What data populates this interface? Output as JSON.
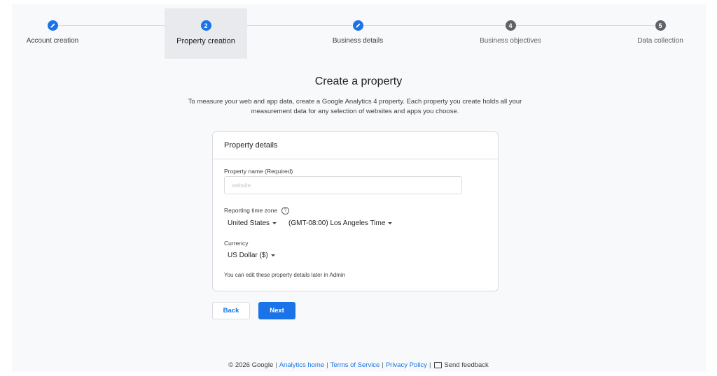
{
  "stepper": {
    "steps": [
      {
        "label": "Account creation",
        "state": "done",
        "icon": "pencil-icon"
      },
      {
        "label": "Property creation",
        "state": "active",
        "number": "2"
      },
      {
        "label": "Business details",
        "state": "done",
        "icon": "pencil-icon"
      },
      {
        "label": "Business objectives",
        "state": "pending",
        "number": "4"
      },
      {
        "label": "Data collection",
        "state": "pending",
        "number": "5"
      }
    ]
  },
  "page": {
    "title": "Create a property",
    "description": "To measure your web and app data, create a Google Analytics 4 property. Each property you create holds all your measurement data for any selection of websites and apps you choose."
  },
  "card": {
    "header": "Property details",
    "property_name_label": "Property name (Required)",
    "property_name_value": "website",
    "time_zone_label": "Reporting time zone",
    "country": "United States",
    "time_zone": "(GMT-08:00) Los Angeles Time",
    "currency_label": "Currency",
    "currency": "US Dollar ($)",
    "note": "You can edit these property details later in Admin"
  },
  "buttons": {
    "back": "Back",
    "next": "Next"
  },
  "footer": {
    "copyright": "© 2026 Google",
    "links": [
      "Analytics home",
      "Terms of Service",
      "Privacy Policy"
    ],
    "feedback": "Send feedback"
  },
  "colors": {
    "accent": "#1a73e8",
    "pending": "#5f6368"
  }
}
